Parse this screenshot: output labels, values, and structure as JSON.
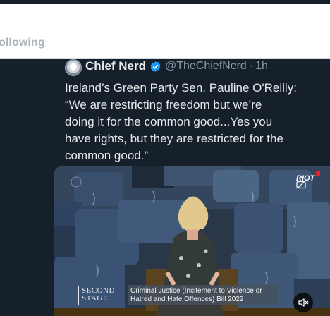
{
  "header": {
    "tab_label": "ollowing"
  },
  "tweet": {
    "author_name": "Chief Nerd",
    "handle": "@TheChiefNerd",
    "separator": "·",
    "time": "1h",
    "text_lines": [
      "Ireland’s Green Party Sen. Pauline O'Reilly:",
      "“We are restricting freedom but we’re",
      "doing it for the common good...Yes you",
      "have rights, but they are restricted for the",
      "common good.”"
    ]
  },
  "media": {
    "stage_label_line1": "SECOND",
    "stage_label_line2": "STAGE",
    "caption": "Criminal Justice (Incitement to Violence or Hatred and Hate Offences) Bill 2022",
    "watermark": "RIOT",
    "mute_icon": "speaker-muted-icon"
  },
  "colors": {
    "background": "#15202b",
    "text": "#e7e9ea",
    "secondary_text": "#8b98a5",
    "verified": "#1d9bf0"
  }
}
